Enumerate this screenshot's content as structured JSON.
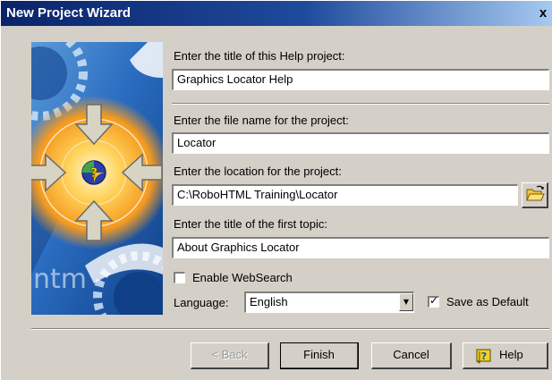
{
  "window": {
    "title": "New Project Wizard",
    "close_glyph": "x"
  },
  "art": {
    "watermark": "ntm"
  },
  "form": {
    "project_title_label": "Enter the title of this Help project:",
    "project_title_value": "Graphics Locator Help",
    "file_name_label": "Enter the file name for the project:",
    "file_name_value": "Locator",
    "location_label": "Enter the location for the project:",
    "location_value": "C:\\RoboHTML Training\\Locator",
    "first_topic_label": "Enter the title of the first topic:",
    "first_topic_value": "About Graphics Locator",
    "websearch_label": "Enable WebSearch",
    "websearch_checked": false,
    "language_label": "Language:",
    "language_value": "English",
    "save_default_label": "Save as Default",
    "save_default_checked": true
  },
  "buttons": {
    "back": "< Back",
    "finish": "Finish",
    "cancel": "Cancel",
    "help": "Help"
  },
  "icons": {
    "browse": "folder-open-icon",
    "help": "help-book-icon",
    "center": "help-sphere-icon"
  },
  "colors": {
    "titlebar_start": "#0a246a",
    "titlebar_end": "#a6caf0",
    "face": "#d4d0c8",
    "art_blue": "#1a5fb0",
    "art_orange": "#f5a623"
  }
}
